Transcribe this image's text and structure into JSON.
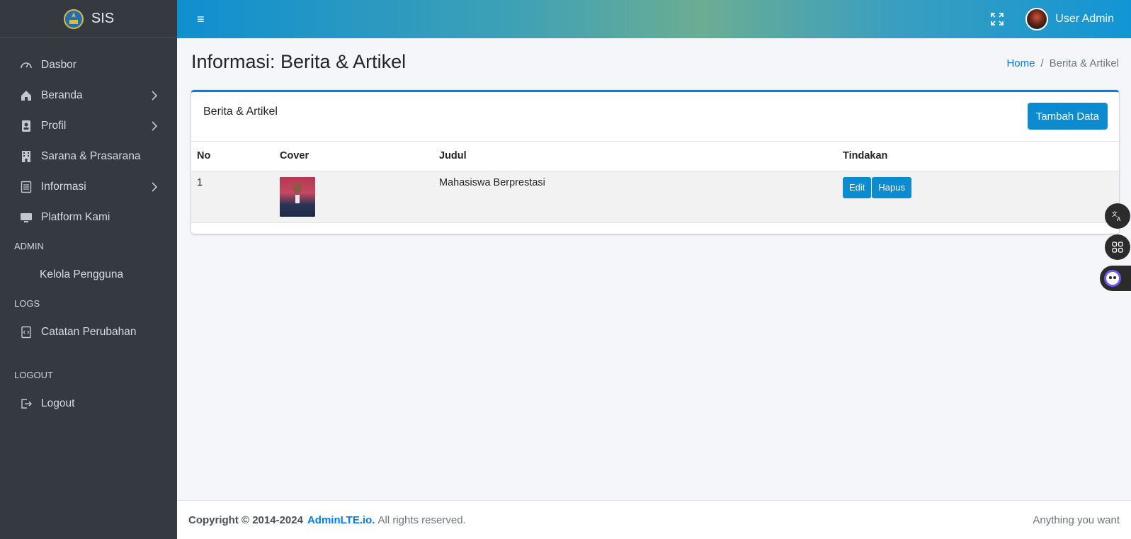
{
  "brand": {
    "name": "SIS",
    "logo_icon": "emblem-logo-icon"
  },
  "sidebar": {
    "items": [
      {
        "label": "Dasbor",
        "icon": "gauge-icon",
        "has_children": false
      },
      {
        "label": "Beranda",
        "icon": "home-icon",
        "has_children": true
      },
      {
        "label": "Profil",
        "icon": "id-badge-icon",
        "has_children": true
      },
      {
        "label": "Sarana & Prasarana",
        "icon": "building-icon",
        "has_children": false
      },
      {
        "label": "Informasi",
        "icon": "document-list-icon",
        "has_children": true
      },
      {
        "label": "Platform Kami",
        "icon": "monitor-icon",
        "has_children": false
      }
    ],
    "sections": {
      "admin": "ADMIN",
      "admin_items": [
        {
          "label": "Kelola Pengguna"
        }
      ],
      "logs": "LOGS",
      "logs_items": [
        {
          "label": "Catatan Perubahan",
          "icon": "file-code-icon"
        }
      ],
      "logout": "LOGOUT",
      "logout_items": [
        {
          "label": "Logout",
          "icon": "logout-icon"
        }
      ]
    }
  },
  "topbar": {
    "menu_glyph": "≡",
    "username": "User Admin"
  },
  "page": {
    "title": "Informasi: Berita & Artikel",
    "breadcrumb": {
      "home": "Home",
      "separator": "/",
      "current": "Berita & Artikel"
    }
  },
  "card": {
    "title": "Berita & Artikel",
    "add_button": "Tambah Data",
    "columns": [
      "No",
      "Cover",
      "Judul",
      "Tindakan"
    ],
    "rows": [
      {
        "no": "1",
        "judul": "Mahasiswa Berprestasi",
        "edit": "Edit",
        "delete": "Hapus"
      }
    ]
  },
  "footer": {
    "copyright": "Copyright © 2014-2024",
    "link": "AdminLTE.io.",
    "rights": "All rights reserved.",
    "right_text": "Anything you want"
  },
  "colors": {
    "sidebar_bg": "#343a40",
    "primary": "#0d8bd1",
    "link": "#007bff"
  }
}
